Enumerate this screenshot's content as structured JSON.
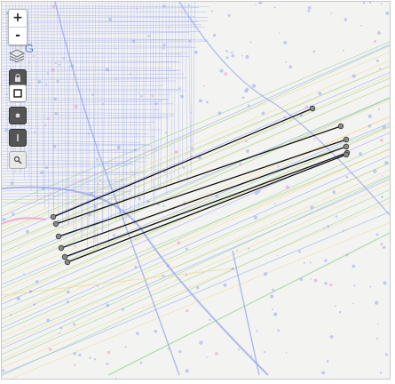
{
  "map": {
    "city_label": "G",
    "zoom_in_label": "+",
    "zoom_out_label": "-",
    "tools": [
      "layers-icon",
      "lock-icon",
      "rectangle-select-icon",
      "point-tool-icon",
      "line-tool-icon",
      "magnifier-icon"
    ],
    "colors": {
      "background": "#f3f3f1",
      "road_blue": "#8f9ff0",
      "road_green": "#8fd18f",
      "road_yellow": "#f2d98a",
      "road_pink": "#f08ccf",
      "track_line": "#111111",
      "track_node": "#8a8a8a"
    }
  }
}
